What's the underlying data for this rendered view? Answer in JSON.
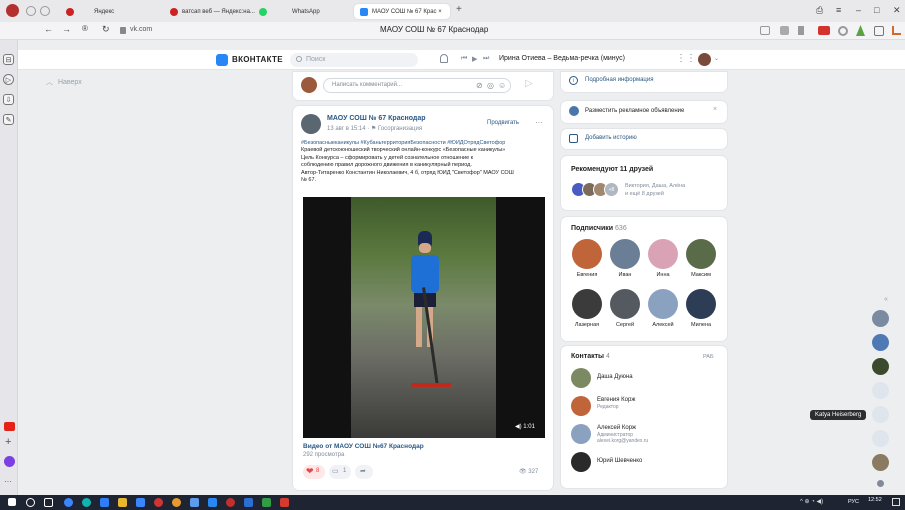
{
  "browser": {
    "tabs": [
      {
        "label": "Яндекс",
        "icon_color": "#cc2222"
      },
      {
        "label": "ватсап веб — Яндекс:на...",
        "icon_color": "#cc2222"
      },
      {
        "label": "WhatsApp",
        "icon_color": "#25d366"
      },
      {
        "label": "МАОУ СОШ № 67 Крас ×",
        "icon_color": "#2787f5"
      }
    ],
    "new_tab": "+",
    "address": "vk.com",
    "page_title": "МАОУ СОШ № 67 Краснодар",
    "window_controls": [
      "–",
      "□",
      "✕"
    ]
  },
  "vk_header": {
    "logo_text": "ВКОНТАКТЕ",
    "search_placeholder": "Поиск",
    "now_playing": "Ирина Отиева – Ведьма-речка (минус)"
  },
  "back_link": "Наверх",
  "comment_box": {
    "placeholder": "Написать комментарий..."
  },
  "post": {
    "author": "МАОУ СОШ № 67 Краснодар",
    "date": "13 авг в 15:14",
    "org": "Госорганизация",
    "promote": "Продвигать",
    "more": "···",
    "hashtags": "#Безопасныеканикулы #КубаньтерриторияБезопасности #ЮИДОтрядСветофор",
    "text_lines": [
      "Краевой детскоюношеский творческий онлайн-конкурс «Безопасные каникулы»",
      "Цель Конкурса – сформировать у детей сознательное отношение к",
      "соблюдению правил дорожного движения в каникулярный период.",
      "Автор-Титаренко Константин Николаевич, 4 б, отряд ЮИД \"Светофор\" МАОУ СОШ",
      "№ 67."
    ],
    "video_duration": "1:01",
    "video_title": "Видео от МАОУ СОШ №67 Краснодар",
    "views_label": "292 просмотра",
    "likes": "8",
    "comments": "1",
    "view_count": "327"
  },
  "right": {
    "info_link": "Подробная информация",
    "ad_link": "Разместить рекламное объявление",
    "history_link": "Добавить историю",
    "recommend_title": "Рекомендуют 11 друзей",
    "recommend_more": "+8",
    "recommend_names": "Виктория, Даша, Алёна",
    "recommend_extra": "и ещё 8 друзей",
    "subscribers_title": "Подписчики",
    "subscribers_count": "636",
    "subscribers": [
      {
        "name": "Евгения",
        "color": "#c0643a"
      },
      {
        "name": "Иван",
        "color": "#6a7f95"
      },
      {
        "name": "Инна",
        "color": "#d9a3b5"
      },
      {
        "name": "Максим",
        "color": "#5a6b4a"
      },
      {
        "name": "Лазерная",
        "color": "#3b3b3b"
      },
      {
        "name": "Сергей",
        "color": "#555a60"
      },
      {
        "name": "Алексей",
        "color": "#8aa2c0"
      },
      {
        "name": "Милена",
        "color": "#2d3d55"
      }
    ],
    "contacts_title": "Контакты",
    "contacts_count": "4",
    "contacts_action": "РАБ",
    "contacts": [
      {
        "name": "Даша Дуюна",
        "role": "",
        "email": "",
        "color": "#7b8a63"
      },
      {
        "name": "Евгения Корж",
        "role": "Редактор",
        "email": "",
        "color": "#c0643a"
      },
      {
        "name": "Алексей Корж",
        "role": "Администратор",
        "email": "alexei.korg@yandex.ru",
        "color": "#8aa2c0"
      },
      {
        "name": "Юрий Шевченко",
        "role": "",
        "email": "",
        "color": "#2a2a2a"
      }
    ]
  },
  "tooltip": "Katya Heiserberg",
  "taskbar": {
    "lang": "РУС",
    "time": "12:52"
  }
}
